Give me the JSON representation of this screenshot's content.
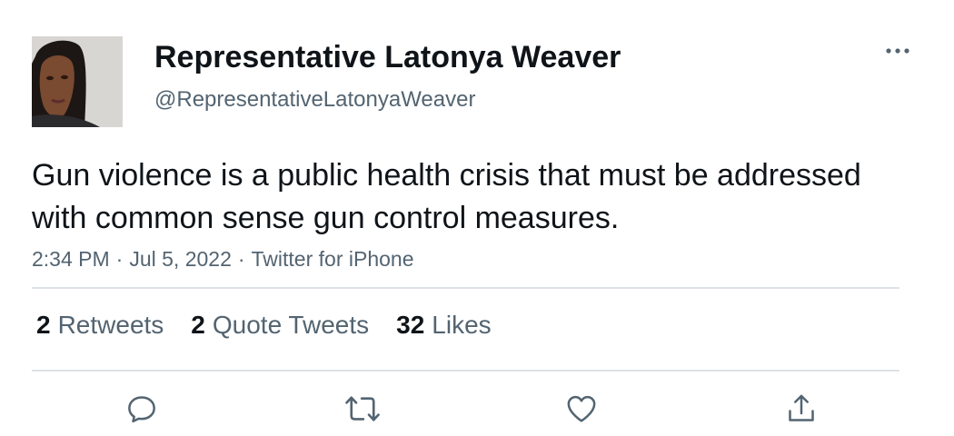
{
  "user": {
    "display_name": "Representative Latonya Weaver",
    "handle": "@RepresentativeLatonyaWeaver",
    "avatar_icon": "profile-photo"
  },
  "tweet": {
    "text": "Gun violence is a public health crisis that must be addressed with common sense gun control measures.",
    "time": "2:34 PM",
    "date": "Jul 5, 2022",
    "source": "Twitter for iPhone",
    "separator": "·"
  },
  "stats": {
    "retweets_count": "2",
    "retweets_label": "Retweets",
    "quote_tweets_count": "2",
    "quote_tweets_label": "Quote Tweets",
    "likes_count": "32",
    "likes_label": "Likes"
  },
  "actions": [
    "reply-icon",
    "retweet-icon",
    "like-icon",
    "share-icon"
  ],
  "colors": {
    "text_primary": "#0f1419",
    "text_secondary": "#536471",
    "divider": "#dde2e6"
  }
}
